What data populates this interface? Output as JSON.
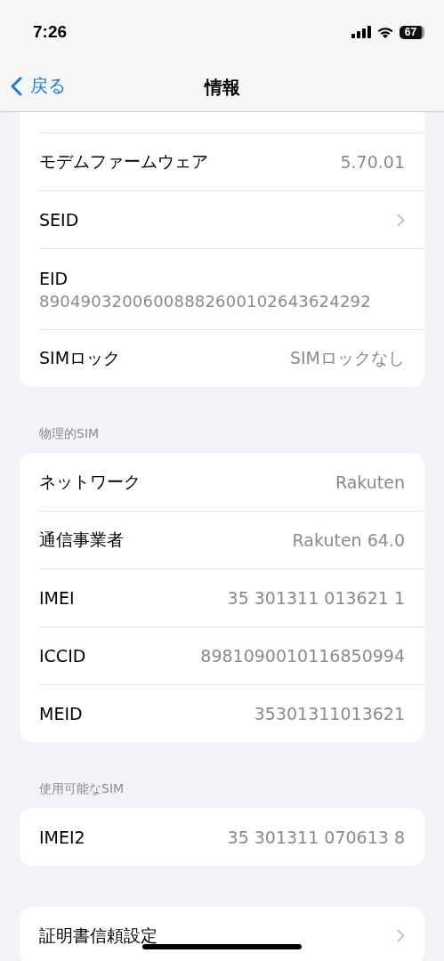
{
  "status_bar": {
    "time": "7:26",
    "battery": "67"
  },
  "nav": {
    "back": "戻る",
    "title": "情報"
  },
  "sections": [
    {
      "cut_off_above": true,
      "rows": [
        {
          "kind": "value",
          "label": "モデムファームウェア",
          "value": "5.70.01"
        },
        {
          "kind": "link",
          "label": "SEID"
        },
        {
          "kind": "stacked",
          "label": "EID",
          "value": "89049032006008882600102643624292"
        },
        {
          "kind": "value",
          "label": "SIMロック",
          "value": "SIMロックなし"
        }
      ]
    },
    {
      "header": "物理的SIM",
      "rows": [
        {
          "kind": "value",
          "label": "ネットワーク",
          "value": "Rakuten"
        },
        {
          "kind": "value",
          "label": "通信事業者",
          "value": "Rakuten 64.0"
        },
        {
          "kind": "value",
          "label": "IMEI",
          "value": "35 301311 013621 1"
        },
        {
          "kind": "value",
          "label": "ICCID",
          "value": "8981090010116850994"
        },
        {
          "kind": "value",
          "label": "MEID",
          "value": "35301311013621"
        }
      ]
    },
    {
      "header": "使用可能なSIM",
      "rows": [
        {
          "kind": "value",
          "label": "IMEI2",
          "value": "35 301311 070613 8"
        }
      ]
    },
    {
      "rows": [
        {
          "kind": "link",
          "label": "証明書信頼設定"
        }
      ]
    }
  ]
}
